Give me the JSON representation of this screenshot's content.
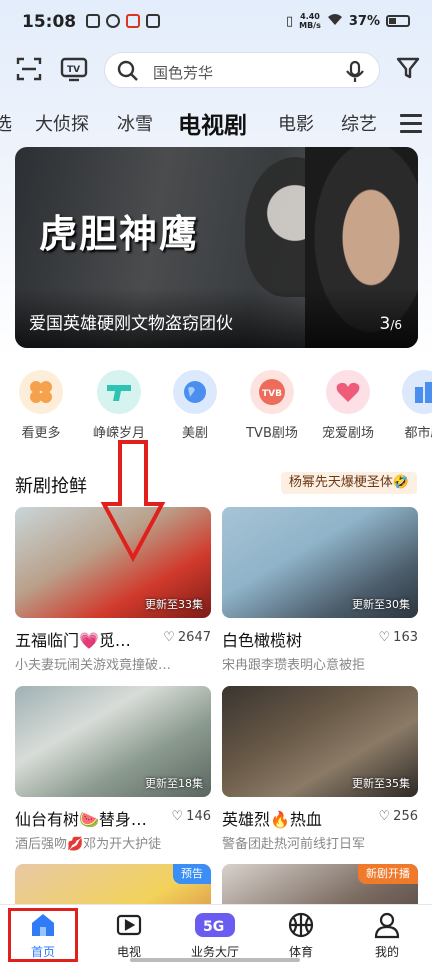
{
  "status_bar": {
    "time": "15:08",
    "net_speed_value": "4.40",
    "net_speed_unit": "MB/s",
    "battery": "37%"
  },
  "search": {
    "placeholder": "国色芳华"
  },
  "tabs": [
    {
      "label": "选"
    },
    {
      "label": "大侦探"
    },
    {
      "label": "冰雪"
    },
    {
      "label": "电视剧",
      "active": true
    },
    {
      "label": "电影"
    },
    {
      "label": "综艺"
    }
  ],
  "banner": {
    "logo_text": "虎胆神鹰",
    "caption": "爱国英雄硬刚文物盗窃团伙",
    "page_current": "3",
    "page_total": "/6"
  },
  "categories": [
    {
      "label": "看更多",
      "icon": "four-petal-icon",
      "color": "#f6a14c"
    },
    {
      "label": "峥嵘岁月",
      "icon": "gun-icon",
      "color": "#2fc3b4"
    },
    {
      "label": "美剧",
      "icon": "globe-icon",
      "color": "#4a8ff0"
    },
    {
      "label": "TVB剧场",
      "icon": "tvb-icon",
      "color": "#ef6b5a"
    },
    {
      "label": "宠爱剧场",
      "icon": "heart-icon",
      "color": "#ef5c7a"
    },
    {
      "label": "都市剧",
      "icon": "city-icon",
      "color": "#4a8ff0"
    }
  ],
  "section": {
    "title": "新剧抢鲜",
    "tag": "杨幂先天爆梗圣体🤣"
  },
  "cards": [
    {
      "title": "五福临门💗觅…",
      "likes": "2647",
      "sub": "小夫妻玩闹关游戏竟撞破…",
      "update": "更新至33集",
      "badge": ""
    },
    {
      "title": "白色橄榄树",
      "likes": "163",
      "sub": "宋冉跟李瓒表明心意被拒",
      "update": "更新至30集",
      "badge": ""
    },
    {
      "title": "仙台有树🍉替身…",
      "likes": "146",
      "sub": "酒后强吻💋邓为开大护徒",
      "update": "更新至18集",
      "badge": ""
    },
    {
      "title": "英雄烈🔥热血",
      "likes": "256",
      "sub": "警备团赴热河前线打日军",
      "update": "更新至35集",
      "badge": ""
    },
    {
      "title": "",
      "likes": "",
      "sub": "",
      "update": "",
      "badge": "预告"
    },
    {
      "title": "",
      "likes": "",
      "sub": "",
      "update": "",
      "badge": "新剧开播"
    }
  ],
  "bottom_nav": [
    {
      "label": "首页",
      "active": true
    },
    {
      "label": "电视"
    },
    {
      "label": "业务大厅"
    },
    {
      "label": "体育"
    },
    {
      "label": "我的"
    }
  ],
  "colors": {
    "accent": "#2f7cf6",
    "annotation": "#e0201c"
  }
}
